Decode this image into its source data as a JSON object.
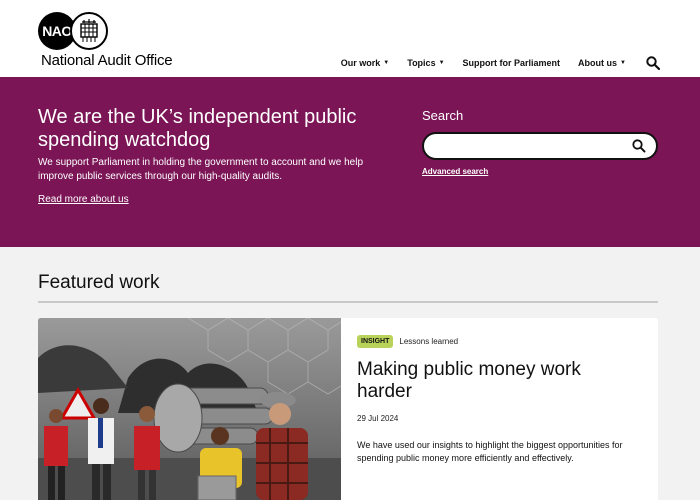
{
  "header": {
    "logo_abbr": "NAO",
    "logo_name": "National Audit Office",
    "nav": [
      {
        "label": "Our work",
        "dropdown": true
      },
      {
        "label": "Topics",
        "dropdown": true
      },
      {
        "label": "Support for Parliament",
        "dropdown": false
      },
      {
        "label": "About us",
        "dropdown": true
      }
    ],
    "search_icon": "search-icon"
  },
  "hero": {
    "title": "We are the UK’s independent public spending watchdog",
    "description": "We support Parliament in holding the government to account and we help improve public services through our high-quality audits.",
    "link": "Read more about us",
    "search_label": "Search",
    "search_value": "",
    "advanced_search": "Advanced search"
  },
  "featured": {
    "heading": "Featured work",
    "card": {
      "tag": "INSIGHT",
      "category": "Lessons learned",
      "title": "Making public money work harder",
      "date": "29 Jul 2024",
      "summary": "We have used our insights to highlight the biggest opportunities for spending public money more efficiently and effectively."
    }
  },
  "colors": {
    "brand": "#7b1556",
    "tag": "#b9d25a"
  }
}
